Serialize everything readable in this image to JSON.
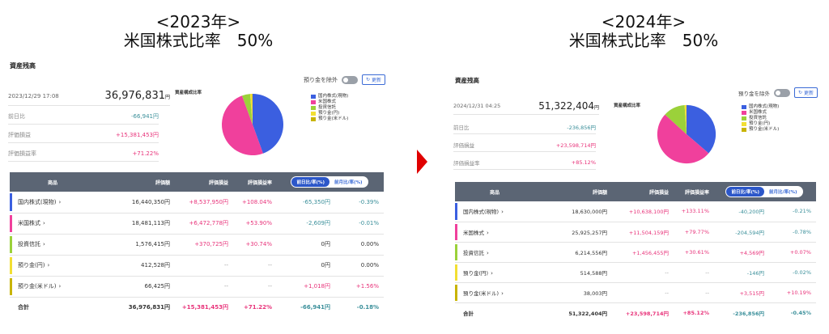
{
  "headings": {
    "left": {
      "year": "<2023年>",
      "ratio": "米国株式比率　50%"
    },
    "right": {
      "year": "<2024年>",
      "ratio": "米国株式比率　50%"
    }
  },
  "common": {
    "title": "資産残高",
    "toggle_label": "預り金を除外",
    "refresh_label": "更新",
    "refresh_icon": "↻",
    "pie_title": "資産構成比率",
    "summary_labels": {
      "prev": "前日比",
      "gain": "評価損益",
      "rate": "評価損益率"
    },
    "table_headers": {
      "name": "商品",
      "value": "評価額",
      "gain": "評価損益",
      "rate": "評価損益率"
    },
    "seg_labels": {
      "on": "前日比/率(%)",
      "off": "前月比/率(%)"
    },
    "total_label": "合計",
    "chevron": "›",
    "legend": [
      {
        "label": "国内株式(現物)",
        "color": "#3b5fe0"
      },
      {
        "label": "米国株式",
        "color": "#f0409c"
      },
      {
        "label": "投資信託",
        "color": "#9bd13a"
      },
      {
        "label": "預り金(円)",
        "color": "#f2df33"
      },
      {
        "label": "預り金(米ドル)",
        "color": "#c8b400"
      }
    ]
  },
  "left": {
    "timestamp": "2023/12/29 17:08",
    "total": "36,976,831",
    "yen": "円",
    "prev": "-66,941円",
    "gain": "+15,381,453円",
    "rate": "+71.22%",
    "rows": [
      {
        "name": "国内株式(現物)",
        "value": "16,440,350円",
        "gain": "+8,537,950円",
        "rate": "+108.04%",
        "d": "-65,350円",
        "dr": "-0.39%"
      },
      {
        "name": "米国株式",
        "value": "18,481,113円",
        "gain": "+6,472,778円",
        "rate": "+53.90%",
        "d": "-2,609円",
        "dr": "-0.01%"
      },
      {
        "name": "投資信託",
        "value": "1,576,415円",
        "gain": "+370,725円",
        "rate": "+30.74%",
        "d": "0円",
        "dr": "0.00%"
      },
      {
        "name": "預り金(円)",
        "value": "412,528円",
        "gain": "--",
        "rate": "--",
        "d": "0円",
        "dr": "0.00%"
      },
      {
        "name": "預り金(米ドル)",
        "value": "66,425円",
        "gain": "--",
        "rate": "--",
        "d": "+1,018円",
        "dr": "+1.56%"
      }
    ],
    "totals": {
      "value": "36,976,831円",
      "gain": "+15,381,453円",
      "rate": "+71.22%",
      "d": "-66,941円",
      "dr": "-0.18%"
    },
    "pie_values": [
      16440350,
      18481113,
      1576415,
      412528,
      66425
    ]
  },
  "right": {
    "timestamp": "2024/12/31 04:25",
    "total": "51,322,404",
    "yen": "円",
    "prev": "-236,856円",
    "gain": "+23,598,714円",
    "rate": "+85.12%",
    "rows": [
      {
        "name": "国内株式(現物)",
        "value": "18,630,000円",
        "gain": "+10,638,100円",
        "rate": "+133.11%",
        "d": "-40,200円",
        "dr": "-0.21%"
      },
      {
        "name": "米国株式",
        "value": "25,925,257円",
        "gain": "+11,504,159円",
        "rate": "+79.77%",
        "d": "-204,594円",
        "dr": "-0.78%"
      },
      {
        "name": "投資信託",
        "value": "6,214,556円",
        "gain": "+1,456,455円",
        "rate": "+30.61%",
        "d": "+4,569円",
        "dr": "+0.07%"
      },
      {
        "name": "預り金(円)",
        "value": "514,588円",
        "gain": "--",
        "rate": "--",
        "d": "-146円",
        "dr": "-0.02%"
      },
      {
        "name": "預り金(米ドル)",
        "value": "38,003円",
        "gain": "--",
        "rate": "--",
        "d": "+3,515円",
        "dr": "+10.19%"
      }
    ],
    "totals": {
      "value": "51,322,404円",
      "gain": "+23,598,714円",
      "rate": "+85.12%",
      "d": "-236,856円",
      "dr": "-0.45%"
    },
    "pie_values": [
      18630000,
      25925257,
      6214556,
      514588,
      38003
    ]
  }
}
